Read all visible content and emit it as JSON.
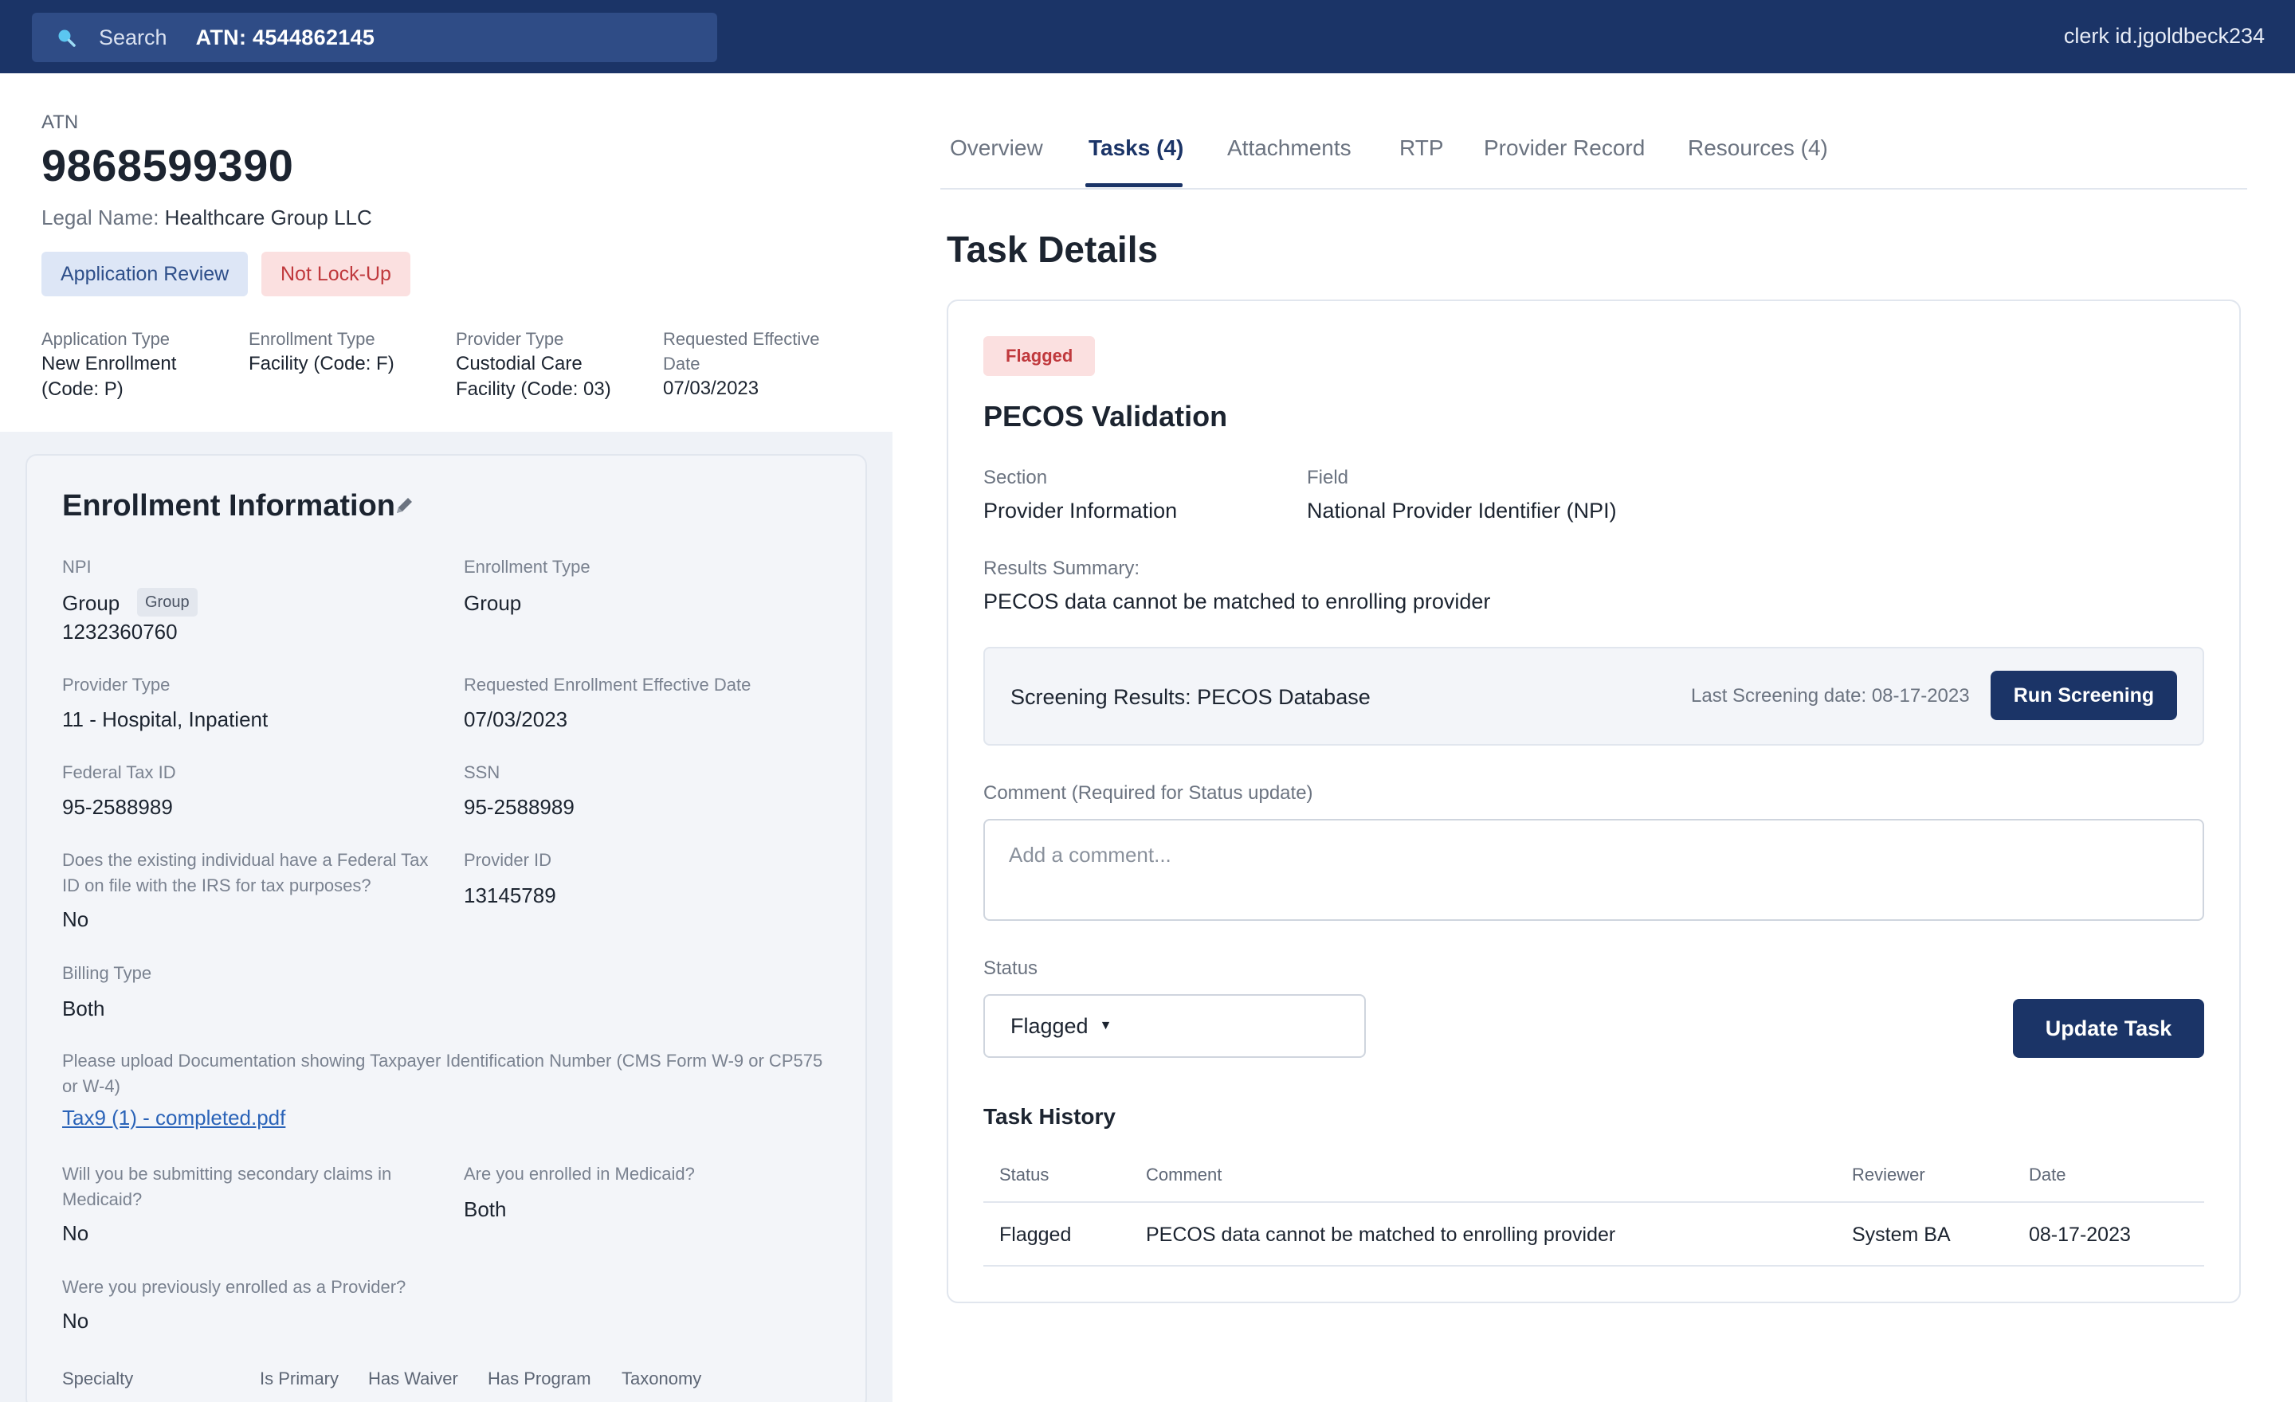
{
  "topbar": {
    "search_label": "Search",
    "search_value": "ATN: 4544862145",
    "user": "clerk id.jgoldbeck234"
  },
  "header": {
    "atn_label": "ATN",
    "atn_number": "9868599390",
    "legal_name_label": "Legal Name:",
    "legal_name": "Healthcare Group LLC",
    "badges": [
      "Application Review",
      "Not Lock-Up"
    ],
    "meta": [
      {
        "label": [
          "Application Type"
        ],
        "value": [
          "New Enrollment",
          "(Code: P)"
        ]
      },
      {
        "label": [
          "Enrollment Type"
        ],
        "value": [
          "Facility (Code: F)"
        ]
      },
      {
        "label": [
          "Provider Type"
        ],
        "value": [
          "Custodial Care",
          "Facility (Code: 03)"
        ]
      },
      {
        "label": [
          "Requested Effective",
          "Date"
        ],
        "value": [
          "07/03/2023"
        ]
      }
    ]
  },
  "enrollment": {
    "title": "Enrollment Information",
    "npi_label": "NPI",
    "npi_type": "Group",
    "npi_chip": "Group",
    "npi_number": "1232360760",
    "enrollment_type_label": "Enrollment Type",
    "enrollment_type": "Group",
    "provider_type_label": "Provider Type",
    "provider_type": "11 - Hospital, Inpatient",
    "req_date_label": "Requested Enrollment Effective Date",
    "req_date": "07/03/2023",
    "tax_id_label": "Federal Tax ID",
    "tax_id": "95-2588989",
    "ssn_label": "SSN",
    "ssn": "95-2588989",
    "irs_q_line1": "Does the existing individual have a Federal Tax",
    "irs_q_line2": "ID on file with the IRS for tax purposes?",
    "irs_a": "No",
    "provider_id_label": "Provider ID",
    "provider_id": "13145789",
    "billing_type_label": "Billing Type",
    "billing_type": "Both",
    "upload_q_line1": "Please upload Documentation showing Taxpayer Identification Number (CMS Form W-9 or CP575",
    "upload_q_line2": "or W-4)",
    "file_link": "Tax9 (1) - completed.pdf",
    "secondary_q_line1": "Will you be submitting secondary claims in",
    "secondary_q_line2": "Medicaid?",
    "secondary_a": "No",
    "medicaid_q": "Are you enrolled in Medicaid?",
    "medicaid_a": "Both",
    "previous_q": "Were you previously enrolled as a Provider?",
    "previous_a": "No",
    "specialty_headers": [
      "Specialty",
      "Is Primary",
      "Has Waiver",
      "Has Program",
      "Taxonomy"
    ]
  },
  "tabs": [
    "Overview",
    "Tasks (4)",
    "Attachments",
    "RTP",
    "Provider Record",
    "Resources (4)"
  ],
  "active_tab": "Tasks (4)",
  "task": {
    "page_title": "Task Details",
    "badge": "Flagged",
    "title": "PECOS Validation",
    "section_label": "Section",
    "section": "Provider Information",
    "field_label": "Field",
    "field": "National Provider Identifier (NPI)",
    "summary_label": "Results Summary:",
    "summary": "PECOS data cannot be matched to enrolling provider",
    "screening_title": "Screening Results: PECOS Database",
    "screening_date": "Last Screening date: 08-17-2023",
    "run_button": "Run Screening",
    "comment_label": "Comment (Required for Status update)",
    "comment_placeholder": "Add a comment...",
    "status_label": "Status",
    "status_value": "Flagged",
    "update_button": "Update Task"
  },
  "history": {
    "title": "Task History",
    "columns": [
      "Status",
      "Comment",
      "Reviewer",
      "Date"
    ],
    "rows": [
      [
        "Flagged",
        "PECOS data cannot be matched to enrolling provider",
        "System BA",
        "08-17-2023"
      ]
    ]
  },
  "colors": {
    "brand_navy": "#1b3467",
    "flag_red": "#c0393d",
    "link_blue": "#2a63b8"
  }
}
